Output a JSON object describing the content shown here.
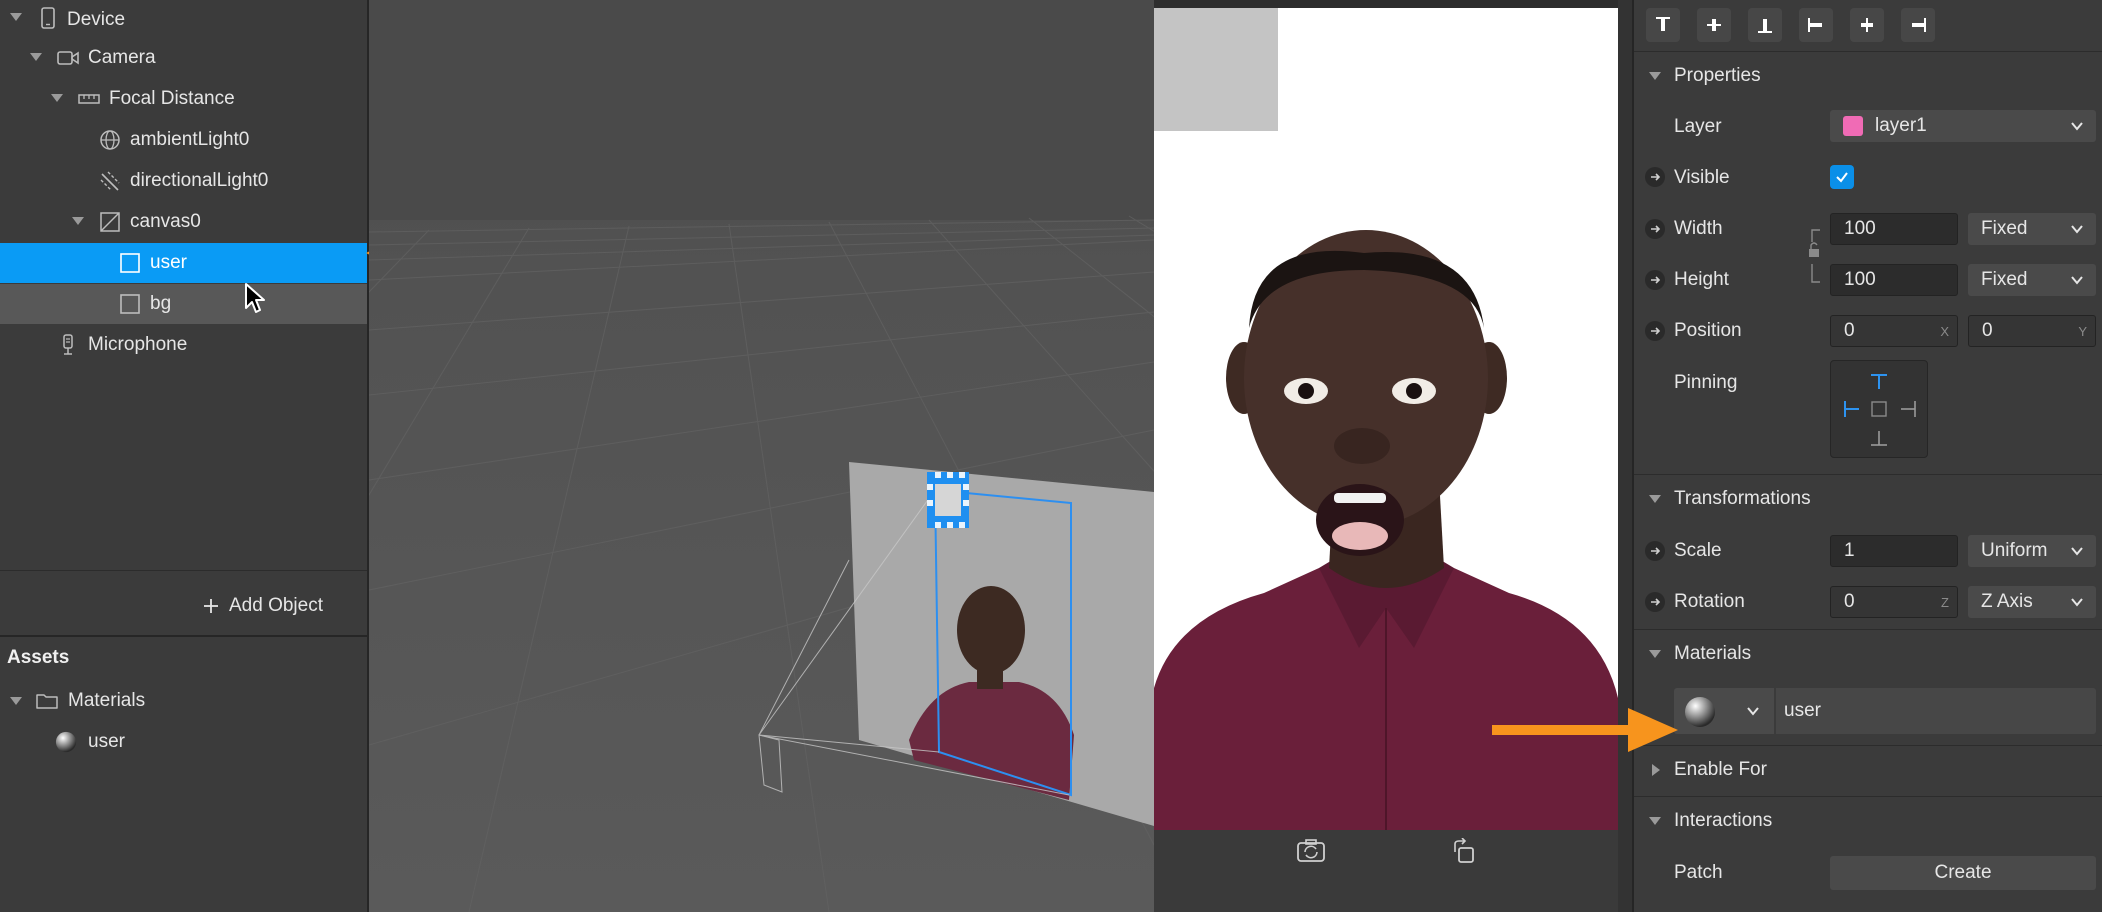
{
  "scene_tree": {
    "items": [
      {
        "label": "Device"
      },
      {
        "label": "Camera"
      },
      {
        "label": "Focal Distance"
      },
      {
        "label": "ambientLight0"
      },
      {
        "label": "directionalLight0"
      },
      {
        "label": "canvas0"
      },
      {
        "label": "user"
      },
      {
        "label": "bg"
      },
      {
        "label": "Microphone"
      }
    ],
    "add_object_label": "Add Object"
  },
  "assets": {
    "title": "Assets",
    "items": [
      {
        "label": "Materials"
      },
      {
        "label": "user"
      }
    ]
  },
  "inspector": {
    "properties": {
      "title": "Properties",
      "layer_label": "Layer",
      "layer_value": "layer1",
      "layer_color": "#f06bb5",
      "visible_label": "Visible",
      "visible_checked": true,
      "width_label": "Width",
      "width_value": "100",
      "width_mode": "Fixed",
      "height_label": "Height",
      "height_value": "100",
      "height_mode": "Fixed",
      "position_label": "Position",
      "position_x": "0",
      "position_x_axis": "X",
      "position_y": "0",
      "position_y_axis": "Y",
      "pinning_label": "Pinning"
    },
    "transformations": {
      "title": "Transformations",
      "scale_label": "Scale",
      "scale_value": "1",
      "scale_mode": "Uniform",
      "rotation_label": "Rotation",
      "rotation_value": "0",
      "rotation_axis": "Z",
      "rotation_mode": "Z Axis"
    },
    "materials": {
      "title": "Materials",
      "material_name": "user"
    },
    "enable_for": {
      "title": "Enable For"
    },
    "interactions": {
      "title": "Interactions",
      "patch_label": "Patch",
      "create_label": "Create"
    }
  },
  "colors": {
    "accent": "#0a9bf5",
    "annotation_arrow": "#f7941d"
  }
}
